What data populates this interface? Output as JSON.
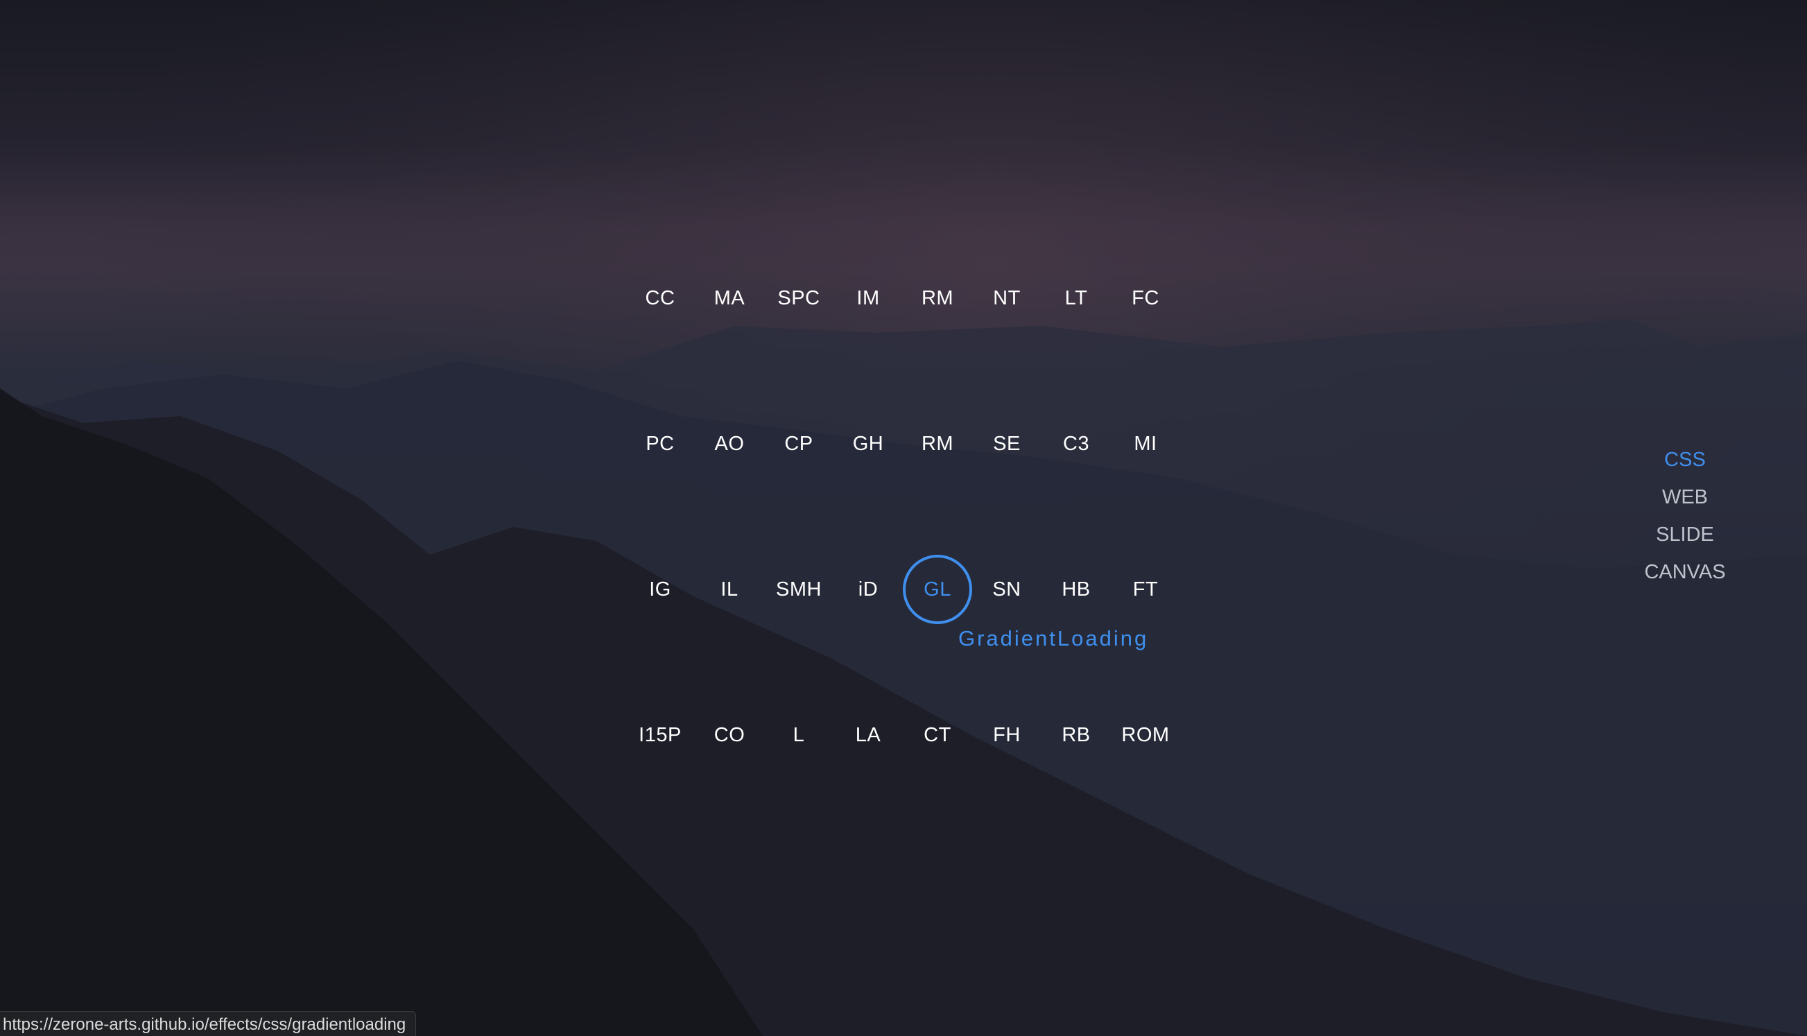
{
  "grid": {
    "rows": [
      [
        "CC",
        "MA",
        "SPC",
        "IM",
        "RM",
        "NT",
        "LT",
        "FC"
      ],
      [
        "PC",
        "AO",
        "CP",
        "GH",
        "RM",
        "SE",
        "C3",
        "MI"
      ],
      [
        "IG",
        "IL",
        "SMH",
        "iD",
        "GL",
        "SN",
        "HB",
        "FT"
      ],
      [
        "I15P",
        "CO",
        "L",
        "LA",
        "CT",
        "FH",
        "RB",
        "ROM"
      ]
    ],
    "active": "GL",
    "active_caption": "GradientLoading"
  },
  "side_menu": {
    "items": [
      "CSS",
      "WEB",
      "SLIDE",
      "CANVAS"
    ],
    "active": "CSS"
  },
  "status_bar": {
    "url": "https://zerone-arts.github.io/effects/css/gradientloading"
  },
  "colors": {
    "accent": "#3f8fee",
    "text": "#ffffff",
    "menu_text": "#bfc3cc"
  }
}
